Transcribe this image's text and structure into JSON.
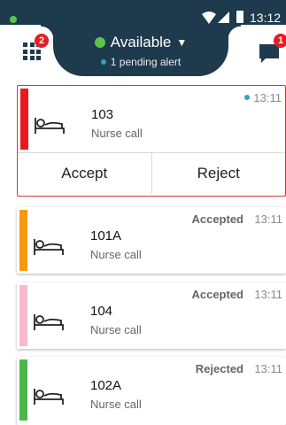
{
  "status_bar": {
    "time": "13:12",
    "icons": [
      "notification-dot-icon",
      "wifi-icon",
      "signal-icon",
      "battery-icon"
    ]
  },
  "header": {
    "availability": "Available",
    "availability_color": "#62c24a",
    "alert_text": "1 pending alert",
    "apps_badge": "2",
    "messages_badge": "1"
  },
  "colors": {
    "header_bg": "#1e3a4d",
    "badge_red": "#e31e24",
    "active_border": "#d9353a",
    "pending_dot": "#2ea7b4"
  },
  "alerts": [
    {
      "room": "103",
      "type": "Nurse call",
      "time": "13:11",
      "status": "",
      "priority_color": "#e8191f",
      "pending": true,
      "accept_label": "Accept",
      "reject_label": "Reject"
    },
    {
      "room": "101A",
      "type": "Nurse call",
      "time": "13:11",
      "status": "Accepted",
      "priority_color": "#f39a12",
      "pending": false
    },
    {
      "room": "104",
      "type": "Nurse call",
      "time": "13:11",
      "status": "Accepted",
      "priority_color": "#f8b8d0",
      "pending": false
    },
    {
      "room": "102A",
      "type": "Nurse call",
      "time": "13:11",
      "status": "Rejected",
      "priority_color": "#4cb848",
      "pending": false
    }
  ]
}
